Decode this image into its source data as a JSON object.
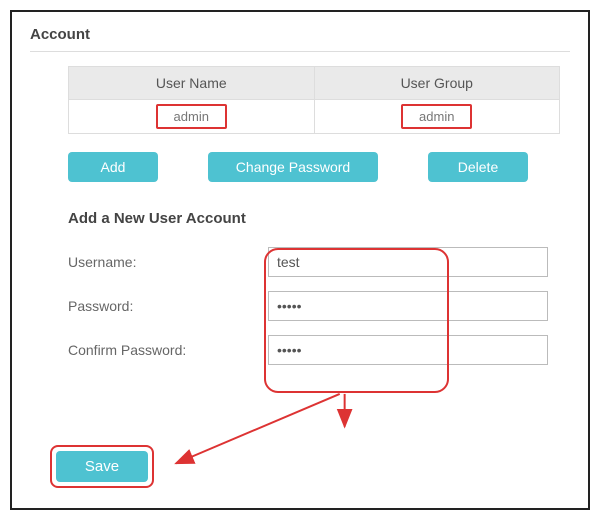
{
  "title": "Account",
  "table": {
    "headers": {
      "username": "User Name",
      "usergroup": "User Group"
    },
    "row": {
      "username": "admin",
      "usergroup": "admin"
    }
  },
  "buttons": {
    "add": "Add",
    "change_password": "Change Password",
    "delete": "Delete",
    "save": "Save"
  },
  "form": {
    "title": "Add a New User Account",
    "username_label": "Username:",
    "password_label": "Password:",
    "confirm_label": "Confirm Password:",
    "username_value": "test",
    "password_value": "•••••",
    "confirm_value": "•••••"
  }
}
